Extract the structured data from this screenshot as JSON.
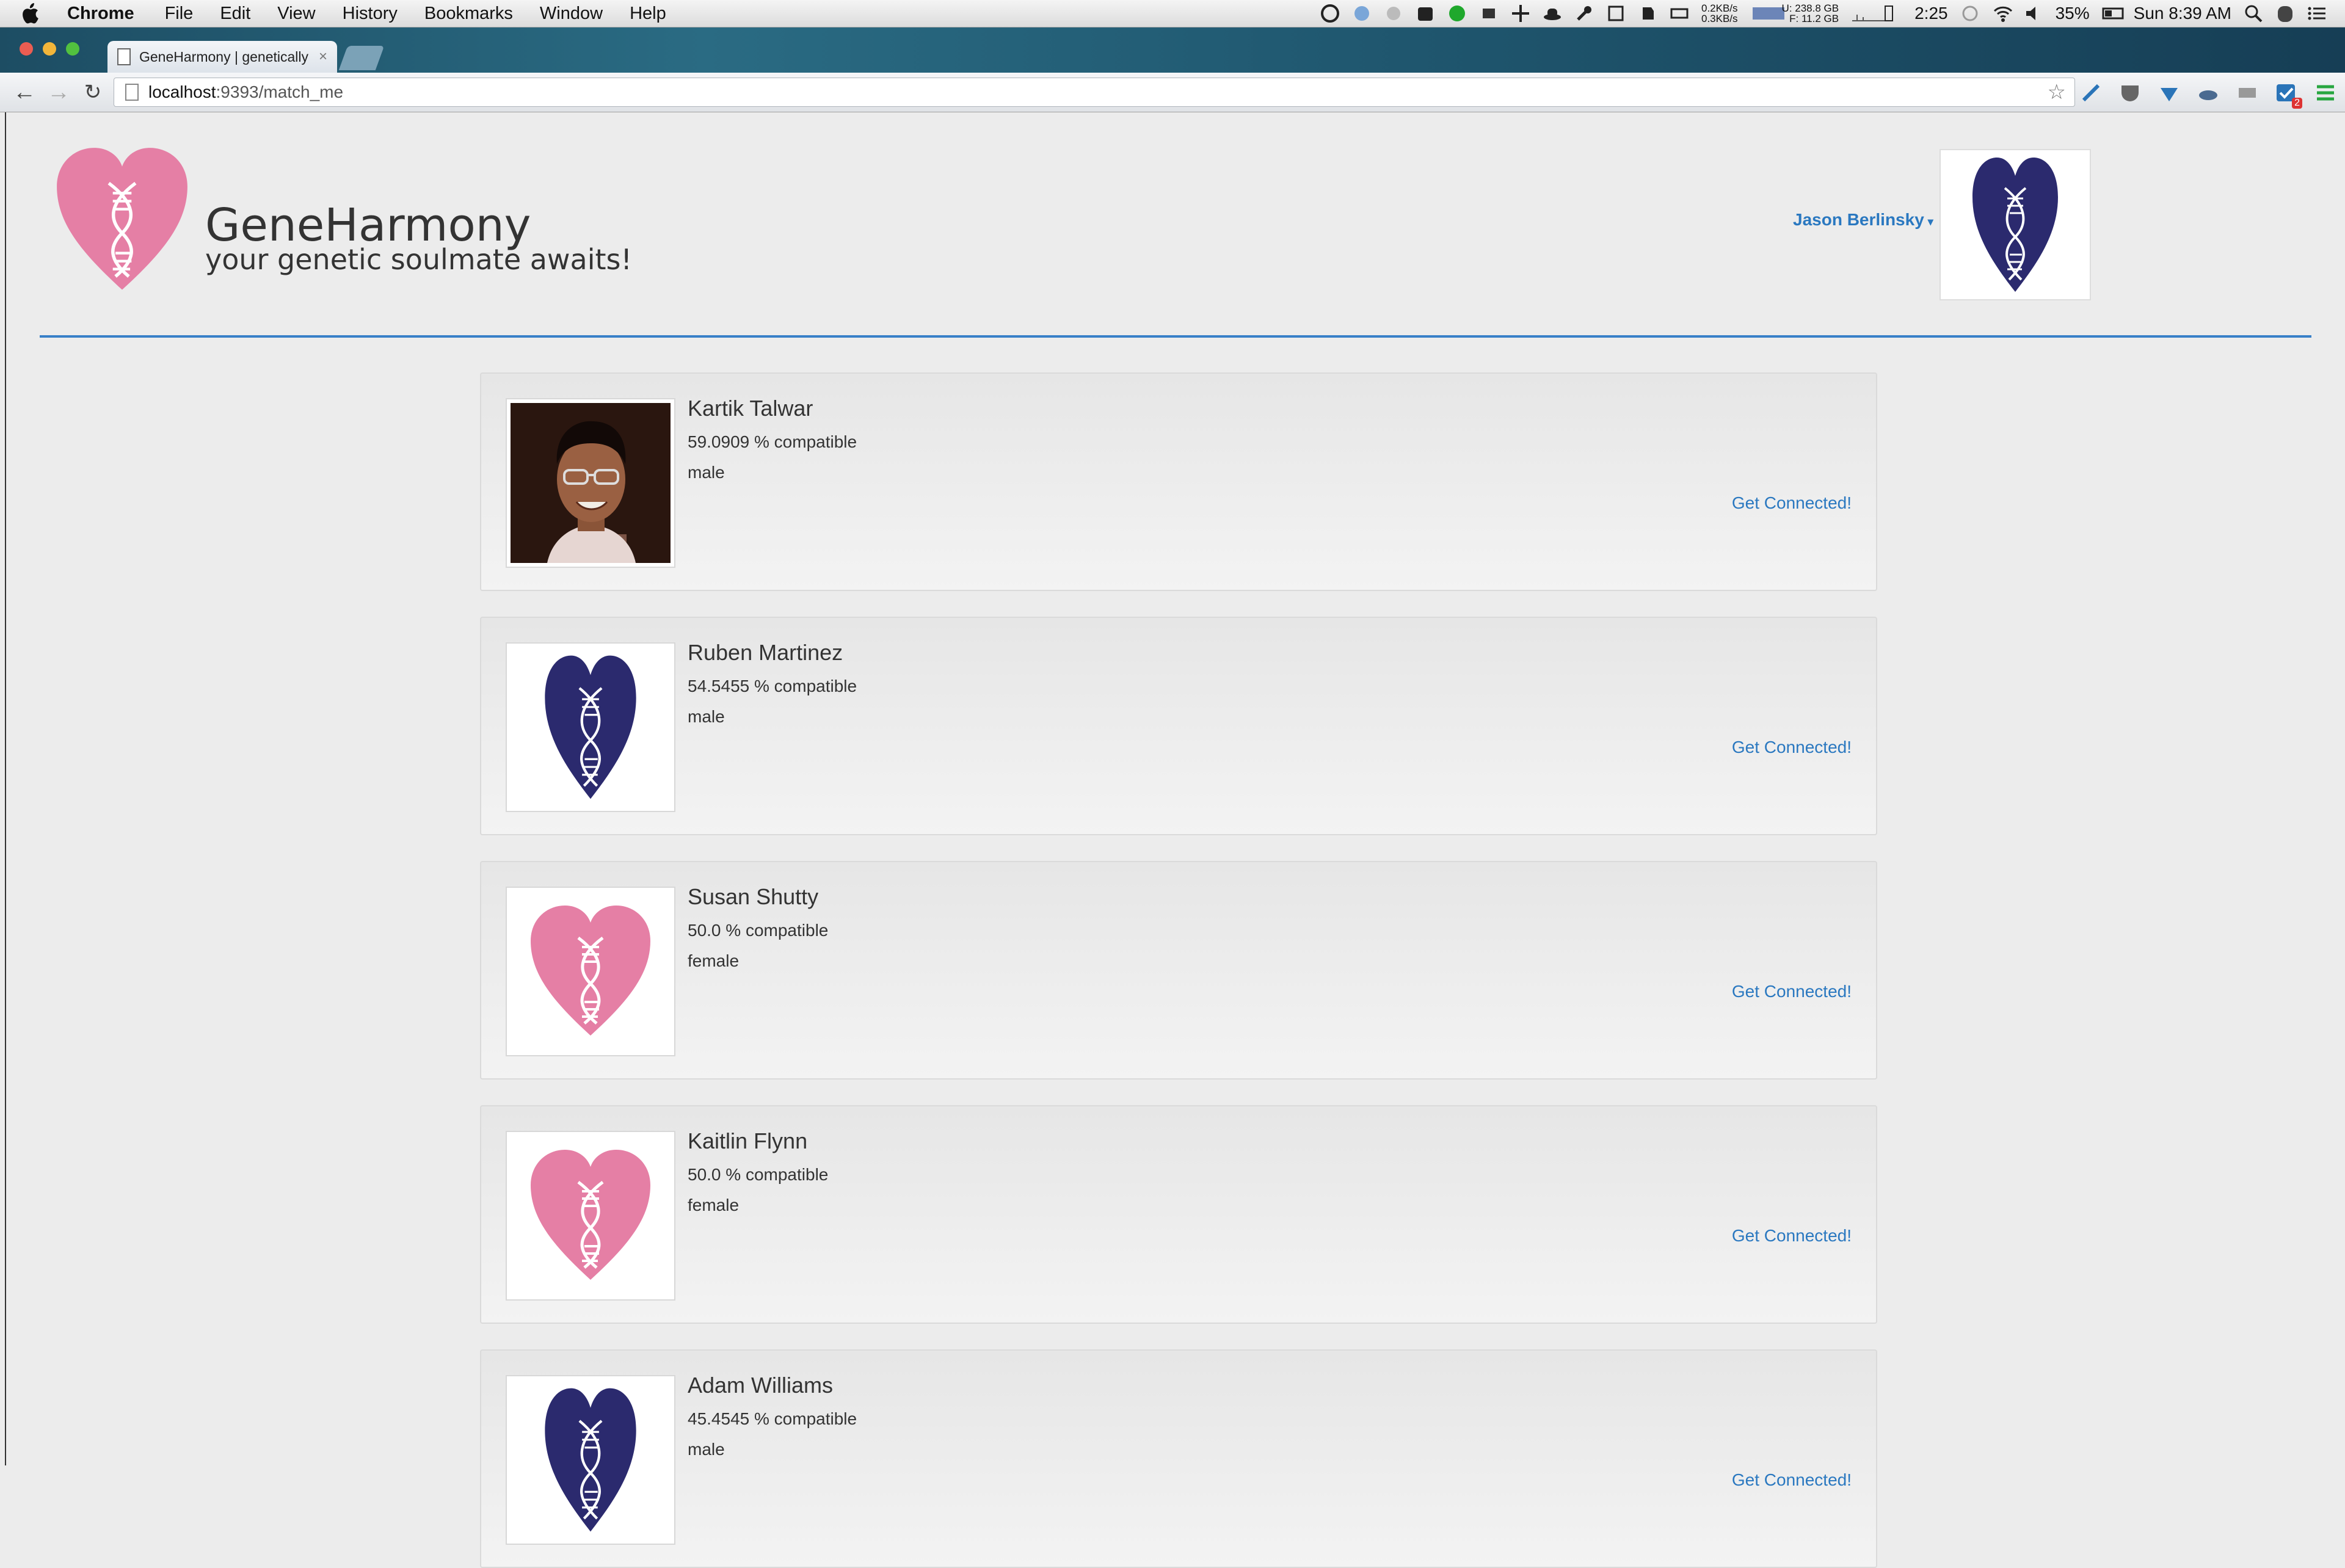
{
  "menubar": {
    "app": "Chrome",
    "menus": [
      "File",
      "Edit",
      "View",
      "History",
      "Bookmarks",
      "Window",
      "Help"
    ],
    "net_up": "0.2KB/s",
    "net_down": "0.3KB/s",
    "disk_used": "U: 238.8 GB",
    "disk_free": "F: 11.2 GB",
    "battery_time": "2:25",
    "battery_pct": "35%",
    "clock": "Sun 8:39 AM"
  },
  "browser": {
    "tab_title": "GeneHarmony | genetically",
    "url_host": "localhost",
    "url_rest": ":9393/match_me",
    "badge_count": "2"
  },
  "site": {
    "title": "GeneHarmony",
    "tagline": "your genetic soulmate awaits!",
    "user_name": "Jason Berlinsky"
  },
  "matches": [
    {
      "name": "Kartik Talwar",
      "compat": "59.0909 % compatible",
      "gender": "male",
      "avatar": "photo",
      "link": "Get Connected!"
    },
    {
      "name": "Ruben Martinez",
      "compat": "54.5455 % compatible",
      "gender": "male",
      "avatar": "navy-heart",
      "link": "Get Connected!"
    },
    {
      "name": "Susan Shutty",
      "compat": "50.0 % compatible",
      "gender": "female",
      "avatar": "pink-heart",
      "link": "Get Connected!"
    },
    {
      "name": "Kaitlin Flynn",
      "compat": "50.0 % compatible",
      "gender": "female",
      "avatar": "pink-heart",
      "link": "Get Connected!"
    },
    {
      "name": "Adam Williams",
      "compat": "45.4545 % compatible",
      "gender": "male",
      "avatar": "navy-heart",
      "link": "Get Connected!"
    }
  ],
  "colors": {
    "pink_heart": "#e57fa5",
    "navy_heart": "#2b2a6e",
    "link": "#2a78c0",
    "rule": "#3880c8"
  }
}
